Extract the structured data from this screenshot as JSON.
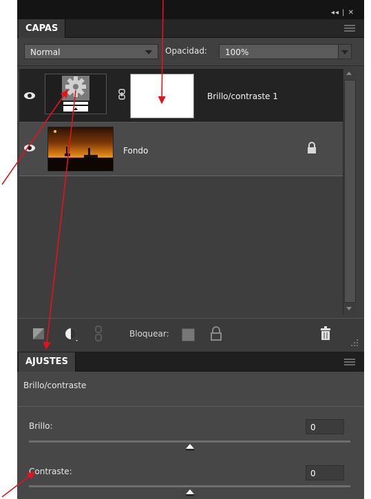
{
  "window": {
    "controls": "◂◂ | ✕"
  },
  "layers_panel": {
    "tab": "CAPAS",
    "blend_mode": "Normal",
    "opacity_label": "Opacidad:",
    "opacity_value": "100%",
    "layers": [
      {
        "name": "Brillo/contraste 1",
        "selected": true,
        "visible": true,
        "type": "adjustment"
      },
      {
        "name": "Fondo",
        "selected": false,
        "visible": true,
        "type": "image",
        "locked": true
      }
    ],
    "lock_label": "Bloquear:"
  },
  "adjustments_panel": {
    "tab": "AJUSTES",
    "title": "Brillo/contraste",
    "brightness": {
      "label": "Brillo:",
      "value": "0",
      "slider_fraction": 0.5
    },
    "contrast": {
      "label": "Contraste:",
      "value": "0",
      "slider_fraction": 0.5
    }
  },
  "annotation_color": "#e8101a"
}
